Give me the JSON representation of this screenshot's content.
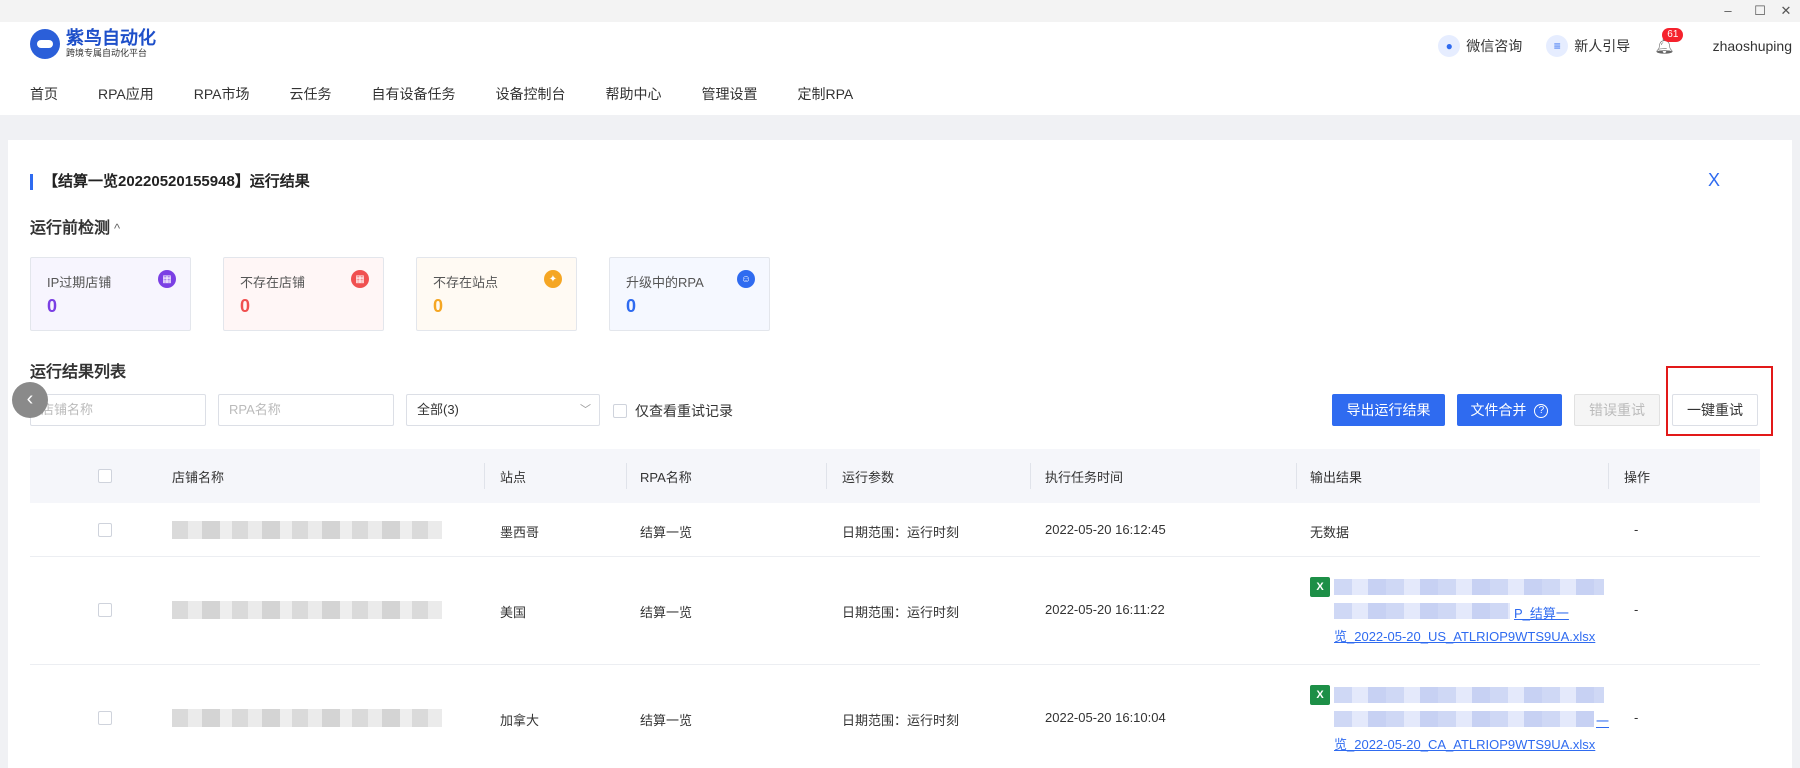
{
  "window": {
    "minimize": "–",
    "maximize": "☐",
    "close": "✕"
  },
  "brand": {
    "title": "紫鸟自动化",
    "subtitle": "跨境专属自动化平台"
  },
  "header": {
    "wechat": "微信咨询",
    "guide": "新人引导",
    "notif_count": "61",
    "user": "zhaoshuping"
  },
  "nav": [
    "首页",
    "RPA应用",
    "RPA市场",
    "云任务",
    "自有设备任务",
    "设备控制台",
    "帮助中心",
    "管理设置",
    "定制RPA"
  ],
  "panel": {
    "title": "【结算一览20220520155948】运行结果",
    "close": "X",
    "precheck_title": "运行前检测",
    "precheck_caret": "^",
    "cards": [
      {
        "label": "IP过期店铺",
        "value": "0",
        "color": "#7b3fe4"
      },
      {
        "label": "不存在店铺",
        "value": "0",
        "color": "#f05050"
      },
      {
        "label": "不存在站点",
        "value": "0",
        "color": "#f5a623"
      },
      {
        "label": "升级中的RPA",
        "value": "0",
        "color": "#2f6bf0"
      }
    ],
    "list_title": "运行结果列表"
  },
  "filters": {
    "shop_placeholder": "店铺名称",
    "rpa_placeholder": "RPA名称",
    "status_value": "全部(3)",
    "retry_only": "仅查看重试记录"
  },
  "actions": {
    "export": "导出运行结果",
    "merge": "文件合并",
    "merge_help": "?",
    "error_retry": "错误重试",
    "one_click_retry": "一键重试"
  },
  "table": {
    "headers": [
      "店铺名称",
      "站点",
      "RPA名称",
      "运行参数",
      "执行任务时间",
      "输出结果",
      "操作"
    ],
    "rows": [
      {
        "site": "墨西哥",
        "rpa": "结算一览",
        "params": "日期范围：运行时刻",
        "time": "2022-05-20 16:12:45",
        "result": "无数据",
        "op": "-"
      },
      {
        "site": "美国",
        "rpa": "结算一览",
        "params": "日期范围：运行时刻",
        "time": "2022-05-20 16:11:22",
        "file_mid": "P_结算一",
        "file_tail": "览_2022-05-20_US_ATLRIOP9WTS9UA.xlsx",
        "op": "-"
      },
      {
        "site": "加拿大",
        "rpa": "结算一览",
        "params": "日期范围：运行时刻",
        "time": "2022-05-20 16:10:04",
        "file_mid": "一",
        "file_tail": "览_2022-05-20_CA_ATLRIOP9WTS9UA.xlsx",
        "op": "-"
      }
    ]
  }
}
